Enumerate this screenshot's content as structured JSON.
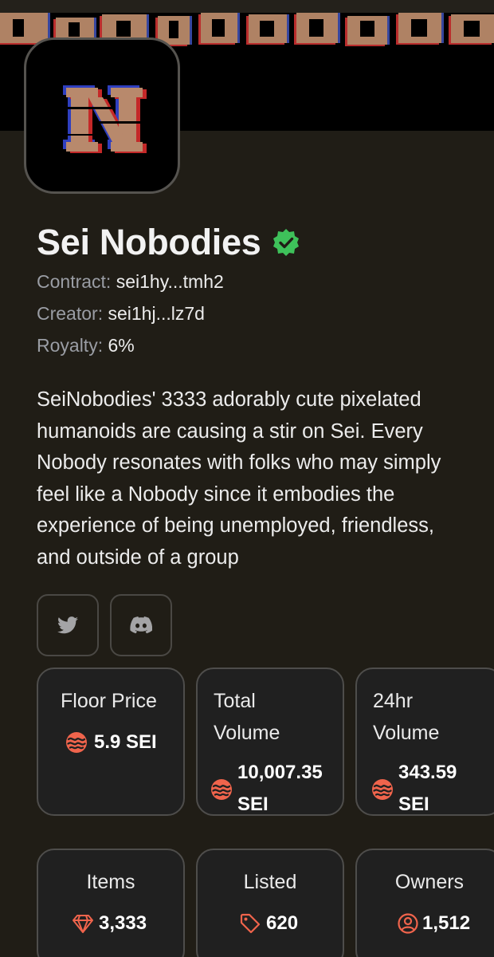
{
  "collection": {
    "name": "Sei Nobodies",
    "avatar_letter": "N",
    "contract_label": "Contract:",
    "contract_value": "sei1hy...tmh2",
    "creator_label": "Creator:",
    "creator_value": "sei1hj...lz7d",
    "royalty_label": "Royalty:",
    "royalty_value": "6%",
    "description": "SeiNobodies' 3333 adorably cute pixelated humanoids are causing a stir on Sei. Every Nobody resonates with folks who may simply feel like a Nobody since it embodies the experience of being unemployed, friendless, and outside of a group"
  },
  "social": {
    "twitter_icon": "twitter-icon",
    "discord_icon": "discord-icon"
  },
  "stats": {
    "floor_label": "Floor Price",
    "floor_value": "5.9 SEI",
    "total_volume_label_1": "Total",
    "total_volume_label_2": "Volume",
    "total_volume_value_1": "10,007.35",
    "total_volume_value_2": "SEI",
    "day_volume_label_1": "24hr",
    "day_volume_label_2": "Volume",
    "day_volume_value_1": "343.59",
    "day_volume_value_2": "SEI",
    "items_label": "Items",
    "items_value": "3,333",
    "listed_label": "Listed",
    "listed_value": "620",
    "owners_label": "Owners",
    "owners_value": "1,512"
  },
  "colors": {
    "background": "#201d16",
    "accent": "#f0644c",
    "verified": "#3ec15a",
    "card": "#202020",
    "muted": "#9a9da4"
  }
}
